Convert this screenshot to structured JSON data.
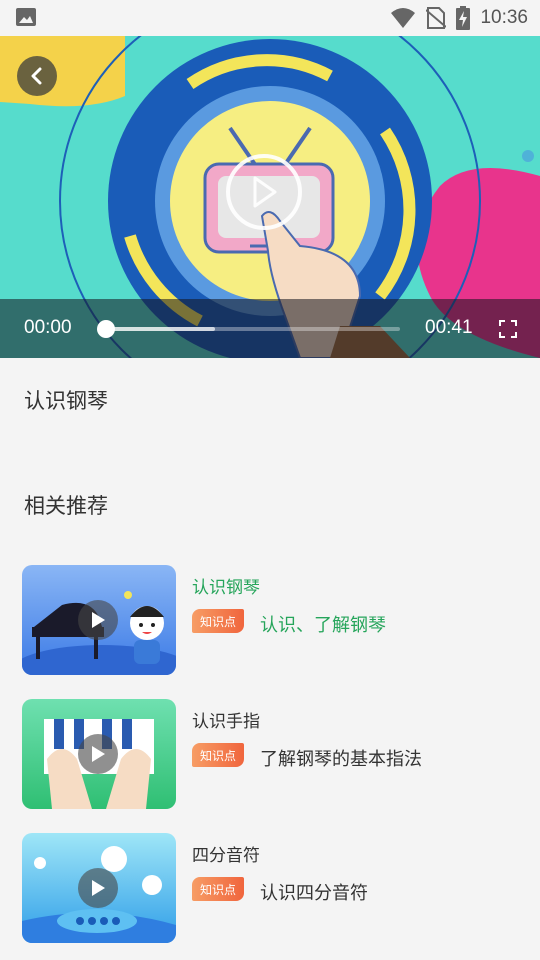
{
  "status_bar": {
    "time": "10:36"
  },
  "player": {
    "current_time": "00:00",
    "duration": "00:41",
    "progress": 0.0,
    "buffered": 0.37
  },
  "video_title": "认识钢琴",
  "section_title": "相关推荐",
  "recommendations": [
    {
      "title": "认识钢琴",
      "tag": "知识点",
      "desc": "认识、了解钢琴",
      "active": true
    },
    {
      "title": "认识手指",
      "tag": "知识点",
      "desc": "了解钢琴的基本指法",
      "active": false
    },
    {
      "title": "四分音符",
      "tag": "知识点",
      "desc": "认识四分音符",
      "active": false
    }
  ],
  "colors": {
    "accent_green": "#26a55b",
    "tag_gradient_start": "#f79d65",
    "tag_gradient_end": "#f0653d",
    "video_bg": "#56dccc"
  }
}
